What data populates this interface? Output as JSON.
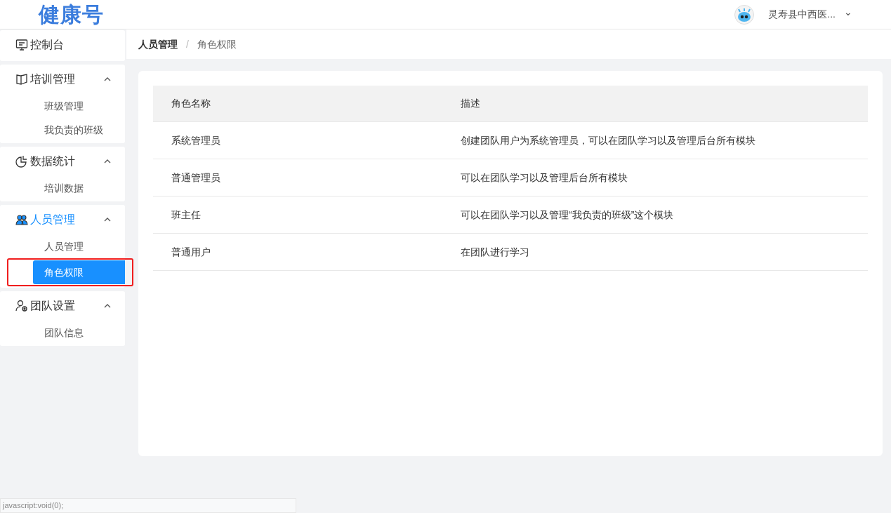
{
  "header": {
    "logo": "健康号",
    "org_name": "灵寿县中西医...",
    "dropdown_caret": "⌄"
  },
  "sidebar": {
    "groups": [
      {
        "label": "控制台",
        "selected": false
      },
      {
        "label": "培训管理",
        "selected": false,
        "expanded": true,
        "children": [
          {
            "label": "班级管理",
            "selected": false,
            "highlighted": false
          },
          {
            "label": "我负责的班级",
            "selected": false,
            "highlighted": false
          }
        ]
      },
      {
        "label": "数据统计",
        "selected": false,
        "expanded": true,
        "children": [
          {
            "label": "培训数据",
            "selected": false,
            "highlighted": false
          }
        ]
      },
      {
        "label": "人员管理",
        "selected": true,
        "expanded": true,
        "children": [
          {
            "label": "人员管理",
            "selected": false,
            "highlighted": false
          },
          {
            "label": "角色权限",
            "selected": true,
            "highlighted": true
          }
        ]
      },
      {
        "label": "团队设置",
        "selected": false,
        "expanded": true,
        "children": [
          {
            "label": "团队信息",
            "selected": false,
            "highlighted": false
          }
        ]
      }
    ]
  },
  "breadcrumb": [
    {
      "label": "人员管理"
    },
    {
      "label": "角色权限"
    }
  ],
  "breadcrumb_separator": "/",
  "table": {
    "columns": [
      "角色名称",
      "描述"
    ],
    "rows": [
      [
        "系统管理员",
        "创建团队用户为系统管理员，可以在团队学习以及管理后台所有模块"
      ],
      [
        "普通管理员",
        "可以在团队学习以及管理后台所有模块"
      ],
      [
        "班主任",
        "可以在团队学习以及管理“我负责的班级”这个模块"
      ],
      [
        "普通用户",
        "在团队进行学习"
      ]
    ]
  },
  "status_bar": {
    "text": "javascript:void(0);"
  }
}
